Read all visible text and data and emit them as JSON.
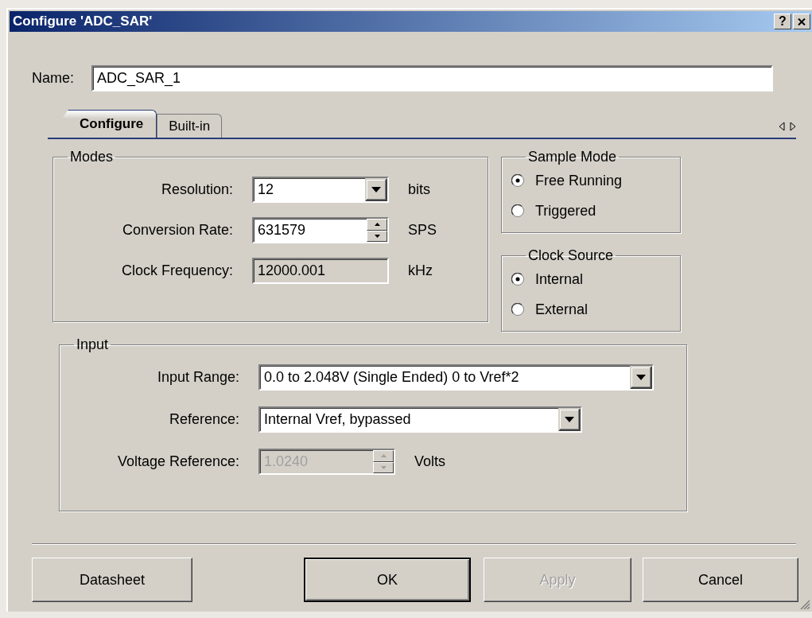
{
  "window": {
    "title": "Configure 'ADC_SAR'",
    "help": "?"
  },
  "name": {
    "label": "Name:",
    "value": "ADC_SAR_1"
  },
  "tabs": [
    {
      "label": "Configure",
      "selected": true
    },
    {
      "label": "Built-in",
      "selected": false
    }
  ],
  "modes": {
    "title": "Modes",
    "rows": [
      {
        "kind": "dropdown",
        "label": "Resolution:",
        "value": "12",
        "unit": "bits",
        "disabled": false
      },
      {
        "kind": "spinner",
        "label": "Conversion Rate:",
        "value": "631579",
        "unit": "SPS",
        "disabled": false
      },
      {
        "kind": "readonly",
        "label": "Clock Frequency:",
        "value": "12000.001",
        "unit": "kHz",
        "disabled": false
      }
    ]
  },
  "sample_mode": {
    "title": "Sample Mode",
    "options": [
      {
        "label": "Free Running",
        "selected": true
      },
      {
        "label": "Triggered",
        "selected": false
      }
    ]
  },
  "clock_source": {
    "title": "Clock Source",
    "options": [
      {
        "label": "Internal",
        "selected": true
      },
      {
        "label": "External",
        "selected": false
      }
    ]
  },
  "input": {
    "title": "Input",
    "rows": [
      {
        "kind": "dropdown",
        "label": "Input Range:",
        "value": "0.0 to 2.048V (Single Ended) 0 to Vref*2",
        "disabled": false
      },
      {
        "kind": "dropdown",
        "label": "Reference:",
        "value": "Internal Vref, bypassed",
        "disabled": false
      },
      {
        "kind": "spinner",
        "label": "Voltage Reference:",
        "value": "1.0240",
        "unit": "Volts",
        "disabled": true
      }
    ]
  },
  "buttons": [
    {
      "label": "Datasheet",
      "default": false,
      "disabled": false
    },
    {
      "label": "OK",
      "default": true,
      "disabled": false
    },
    {
      "label": "Apply",
      "default": false,
      "disabled": true
    },
    {
      "label": "Cancel",
      "default": false,
      "disabled": false
    }
  ]
}
